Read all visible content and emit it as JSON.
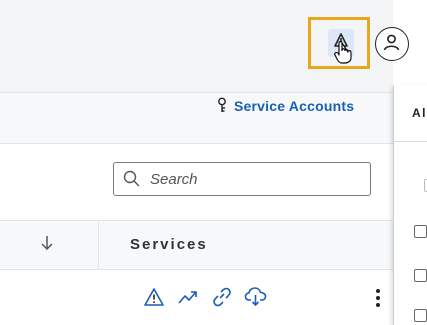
{
  "header": {
    "alert_icon": "triangle-warning-icon",
    "user_icon": "user-icon",
    "highlight_color": "#e8a81c"
  },
  "nav": {
    "service_accounts_label": "Service Accounts",
    "service_accounts_icon": "key-icon",
    "link_color": "#1a5fb4"
  },
  "search": {
    "placeholder": "Search",
    "value": ""
  },
  "table": {
    "sort_icon": "arrow-down-icon",
    "columns": [
      "Services"
    ],
    "row_actions": [
      "warning-icon",
      "trend-up-icon",
      "link-icon",
      "cloud-download-icon"
    ],
    "row_menu_icon": "kebab-menu-icon"
  },
  "panel": {
    "header_text": "Al"
  }
}
